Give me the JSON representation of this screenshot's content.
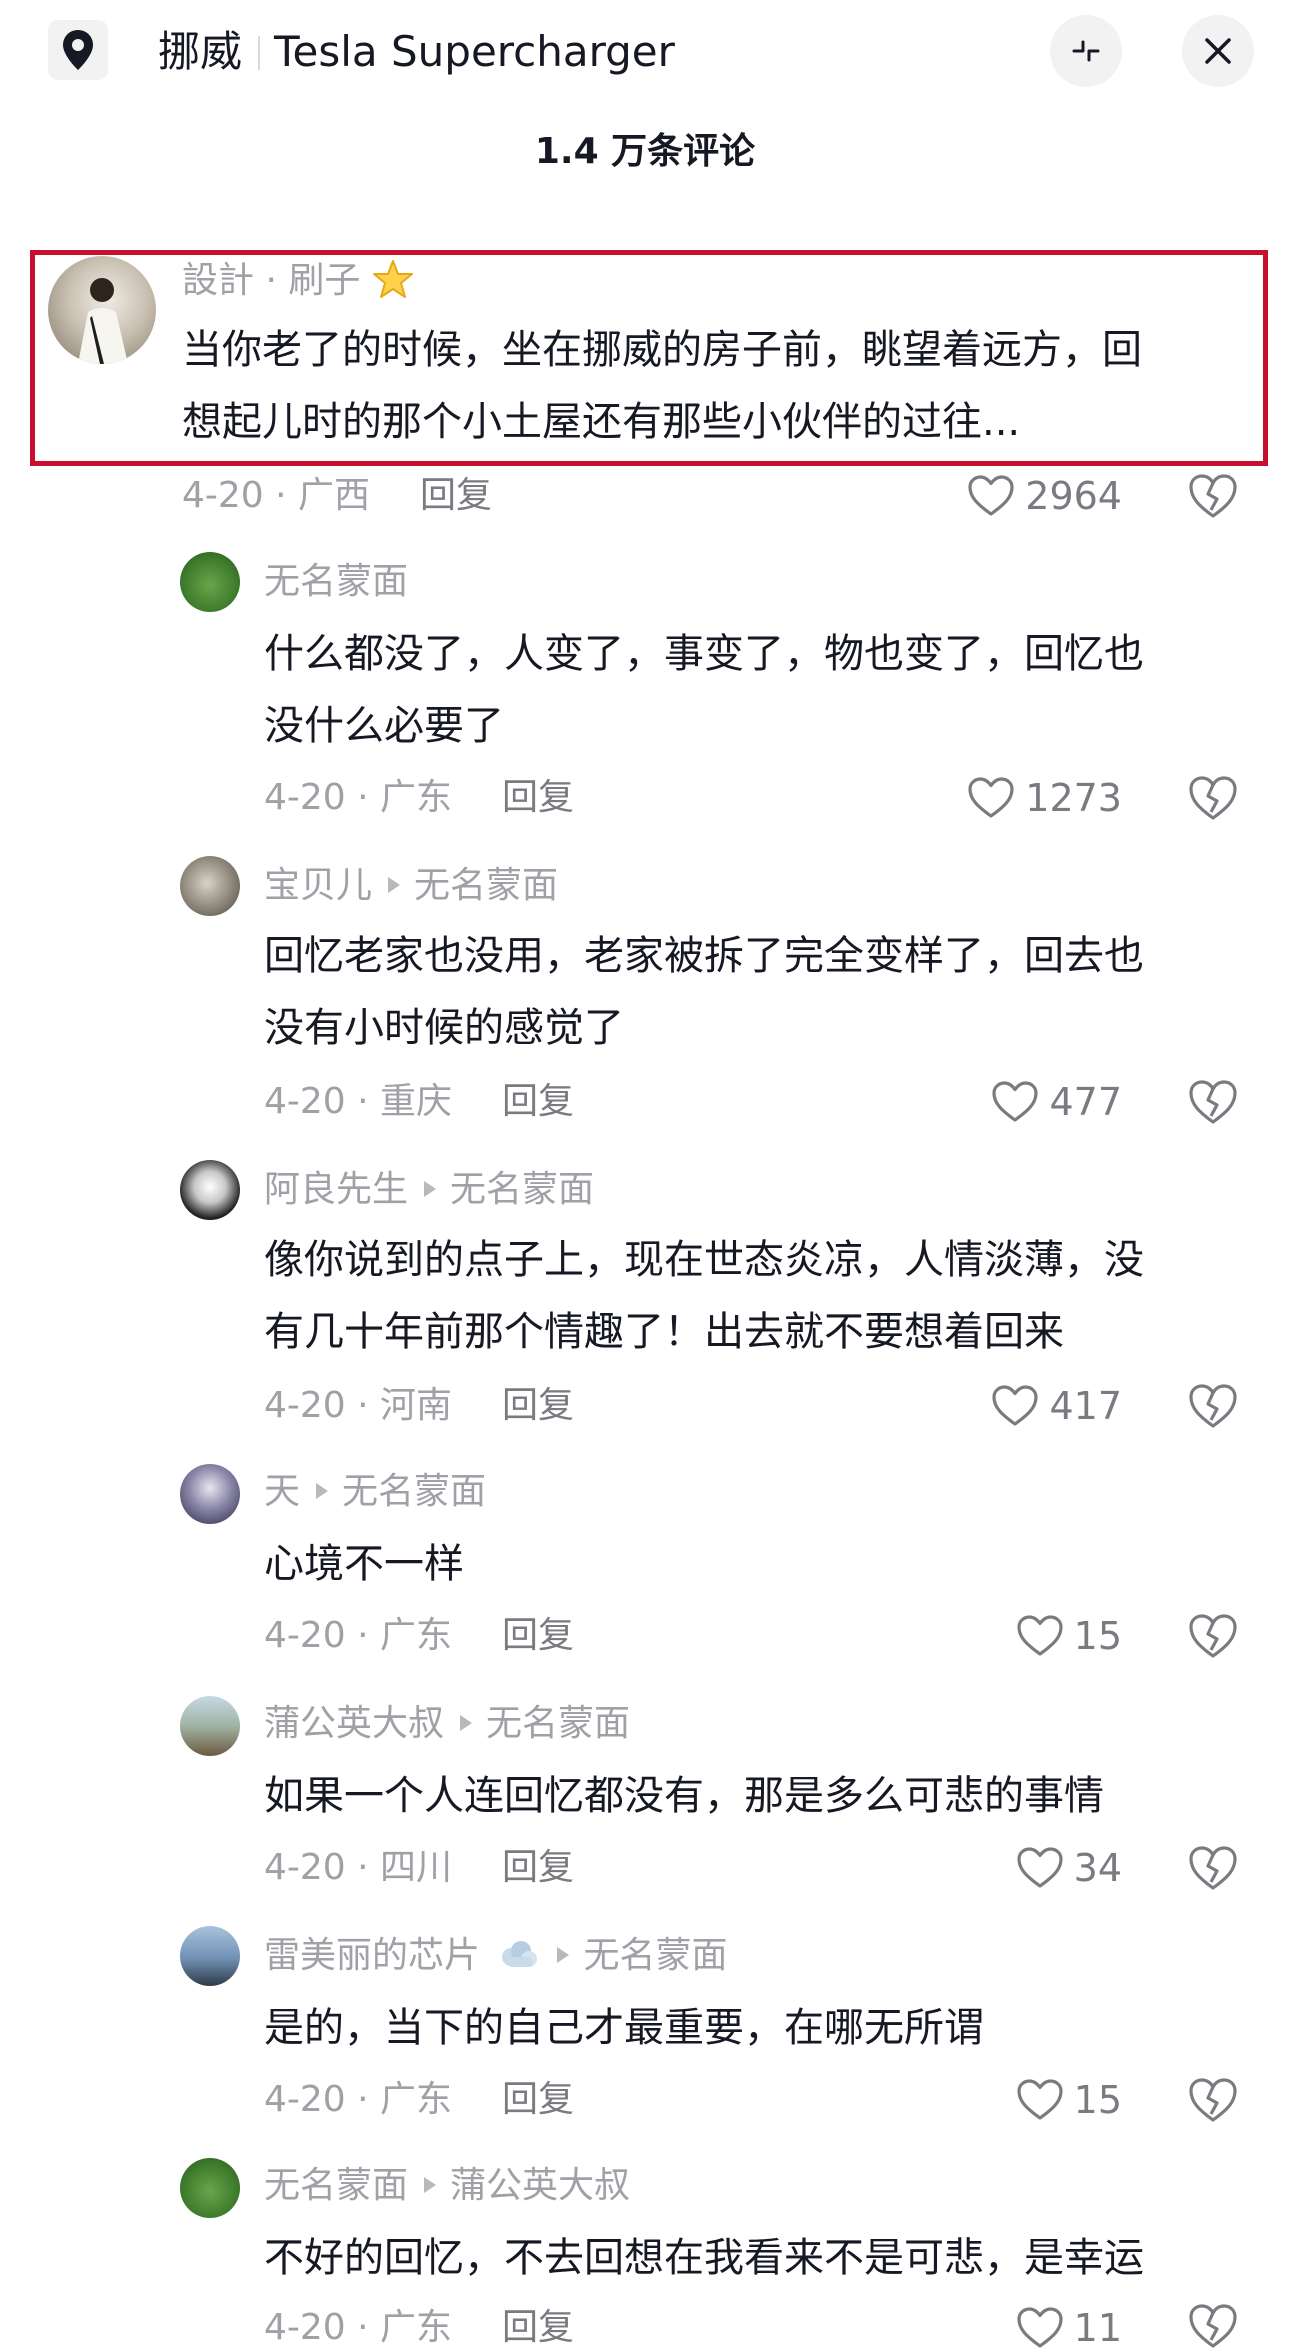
{
  "header": {
    "location_icon": "map-pin-icon",
    "location_name": "挪威",
    "place_name": "Tesla Supercharger",
    "collapse_icon": "collapse-icon",
    "close_icon": "close-icon",
    "comment_count": "1.4 万条评论"
  },
  "colors": {
    "highlight_border": "#c8102e",
    "meta_gray": "#a0a0a6",
    "text": "#161823"
  },
  "comments": [
    {
      "username": "設計 · 刷子",
      "badge_icon": "star-icon",
      "text_line1": "当你老了的时候，坐在挪威的房子前，眺望着远方，回",
      "text_line2": "想起儿时的那个小土屋还有那些小伙伴的过往...",
      "date_loc": "4-20 · 广西",
      "reply_label": "回复",
      "likes": "2964"
    },
    {
      "username": "无名蒙面",
      "text_line1": "什么都没了，人变了，事变了，物也变了，回忆也",
      "text_line2": "没什么必要了",
      "date_loc": "4-20 · 广东",
      "reply_label": "回复",
      "likes": "1273"
    },
    {
      "username": "宝贝儿",
      "reply_to": "无名蒙面",
      "text_line1": "回忆老家也没用，老家被拆了完全变样了，回去也",
      "text_line2": "没有小时候的感觉了",
      "date_loc": "4-20 · 重庆",
      "reply_label": "回复",
      "likes": "477"
    },
    {
      "username": "阿良先生",
      "reply_to": "无名蒙面",
      "text_line1": "像你说到的点子上，现在世态炎凉，人情淡薄，没",
      "text_line2": "有几十年前那个情趣了！出去就不要想着回来",
      "date_loc": "4-20 · 河南",
      "reply_label": "回复",
      "likes": "417"
    },
    {
      "username": "天",
      "reply_to": "无名蒙面",
      "text_line1": "心境不一样",
      "date_loc": "4-20 · 广东",
      "reply_label": "回复",
      "likes": "15"
    },
    {
      "username": "蒲公英大叔",
      "reply_to": "无名蒙面",
      "text_line1": "如果一个人连回忆都没有，那是多么可悲的事情",
      "date_loc": "4-20 · 四川",
      "reply_label": "回复",
      "likes": "34"
    },
    {
      "username": "雷美丽的芯片",
      "badge_icon": "cloud-icon",
      "reply_to": "无名蒙面",
      "text_line1": "是的，当下的自己才最重要，在哪无所谓",
      "date_loc": "4-20 · 广东",
      "reply_label": "回复",
      "likes": "15"
    },
    {
      "username": "无名蒙面",
      "reply_to": "蒲公英大叔",
      "text_line1": "不好的回忆，不去回想在我看来不是可悲，是幸运",
      "date_loc": "4-20 · 广东",
      "reply_label": "回复",
      "likes": "11"
    }
  ]
}
